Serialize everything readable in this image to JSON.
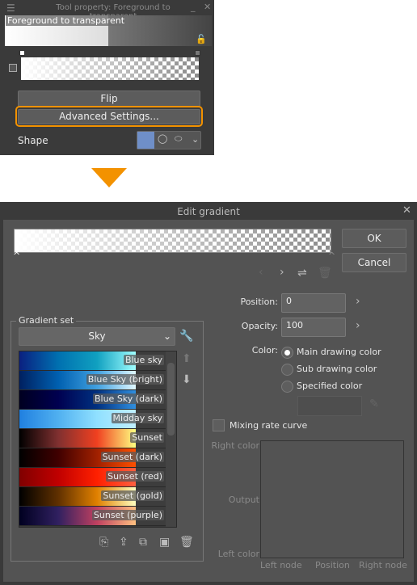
{
  "tool_property": {
    "title": "Tool property: Foreground to transparent",
    "gradient_name": "Foreground to transparent",
    "flip_label": "Flip",
    "advanced_label": "Advanced Settings...",
    "shape_label": "Shape",
    "highlight_color": "#f39200"
  },
  "arrow_color": "#f39200",
  "dialog": {
    "title": "Edit gradient",
    "ok_label": "OK",
    "cancel_label": "Cancel",
    "gradient_set": {
      "legend": "Gradient set",
      "selected": "Sky",
      "items": [
        {
          "label": "Blue sky",
          "colors": [
            "#0a2080",
            "#0070b0",
            "#10a0c0",
            "#a0ffff"
          ]
        },
        {
          "label": "Blue Sky (bright)",
          "colors": [
            "#002060",
            "#0060b0",
            "#40a0e0",
            "#e0f8ff"
          ]
        },
        {
          "label": "Blue Sky (dark)",
          "colors": [
            "#000020",
            "#000050",
            "#003080",
            "#3090e0"
          ]
        },
        {
          "label": "Midday sky",
          "colors": [
            "#2080e0",
            "#50b0f0",
            "#90e0ff",
            "#c0f0ff"
          ]
        },
        {
          "label": "Sunset",
          "colors": [
            "#000000",
            "#803030",
            "#f04020",
            "#ffff80"
          ]
        },
        {
          "label": "Sunset (dark)",
          "colors": [
            "#000000",
            "#400000",
            "#a02000",
            "#ff5000"
          ]
        },
        {
          "label": "Sunset (red)",
          "colors": [
            "#800000",
            "#c00000",
            "#ff2000",
            "#ff6040"
          ]
        },
        {
          "label": "Sunset (gold)",
          "colors": [
            "#000000",
            "#603000",
            "#e08000",
            "#ffffc0"
          ]
        },
        {
          "label": "Sunset (purple)",
          "colors": [
            "#000020",
            "#302060",
            "#c04060",
            "#ffc080"
          ]
        }
      ]
    },
    "position_label": "Position:",
    "position_value": "0",
    "opacity_label": "Opacity:",
    "opacity_value": "100",
    "color_label": "Color:",
    "color_options": [
      {
        "label": "Main drawing color",
        "selected": true
      },
      {
        "label": "Sub drawing color",
        "selected": false
      },
      {
        "label": "Specified color",
        "selected": false
      }
    ],
    "mixing_label": "Mixing rate curve",
    "curve": {
      "right_color": "Right color",
      "output": "Output",
      "left_color": "Left color",
      "left_node": "Left node",
      "position": "Position",
      "right_node": "Right node"
    }
  }
}
